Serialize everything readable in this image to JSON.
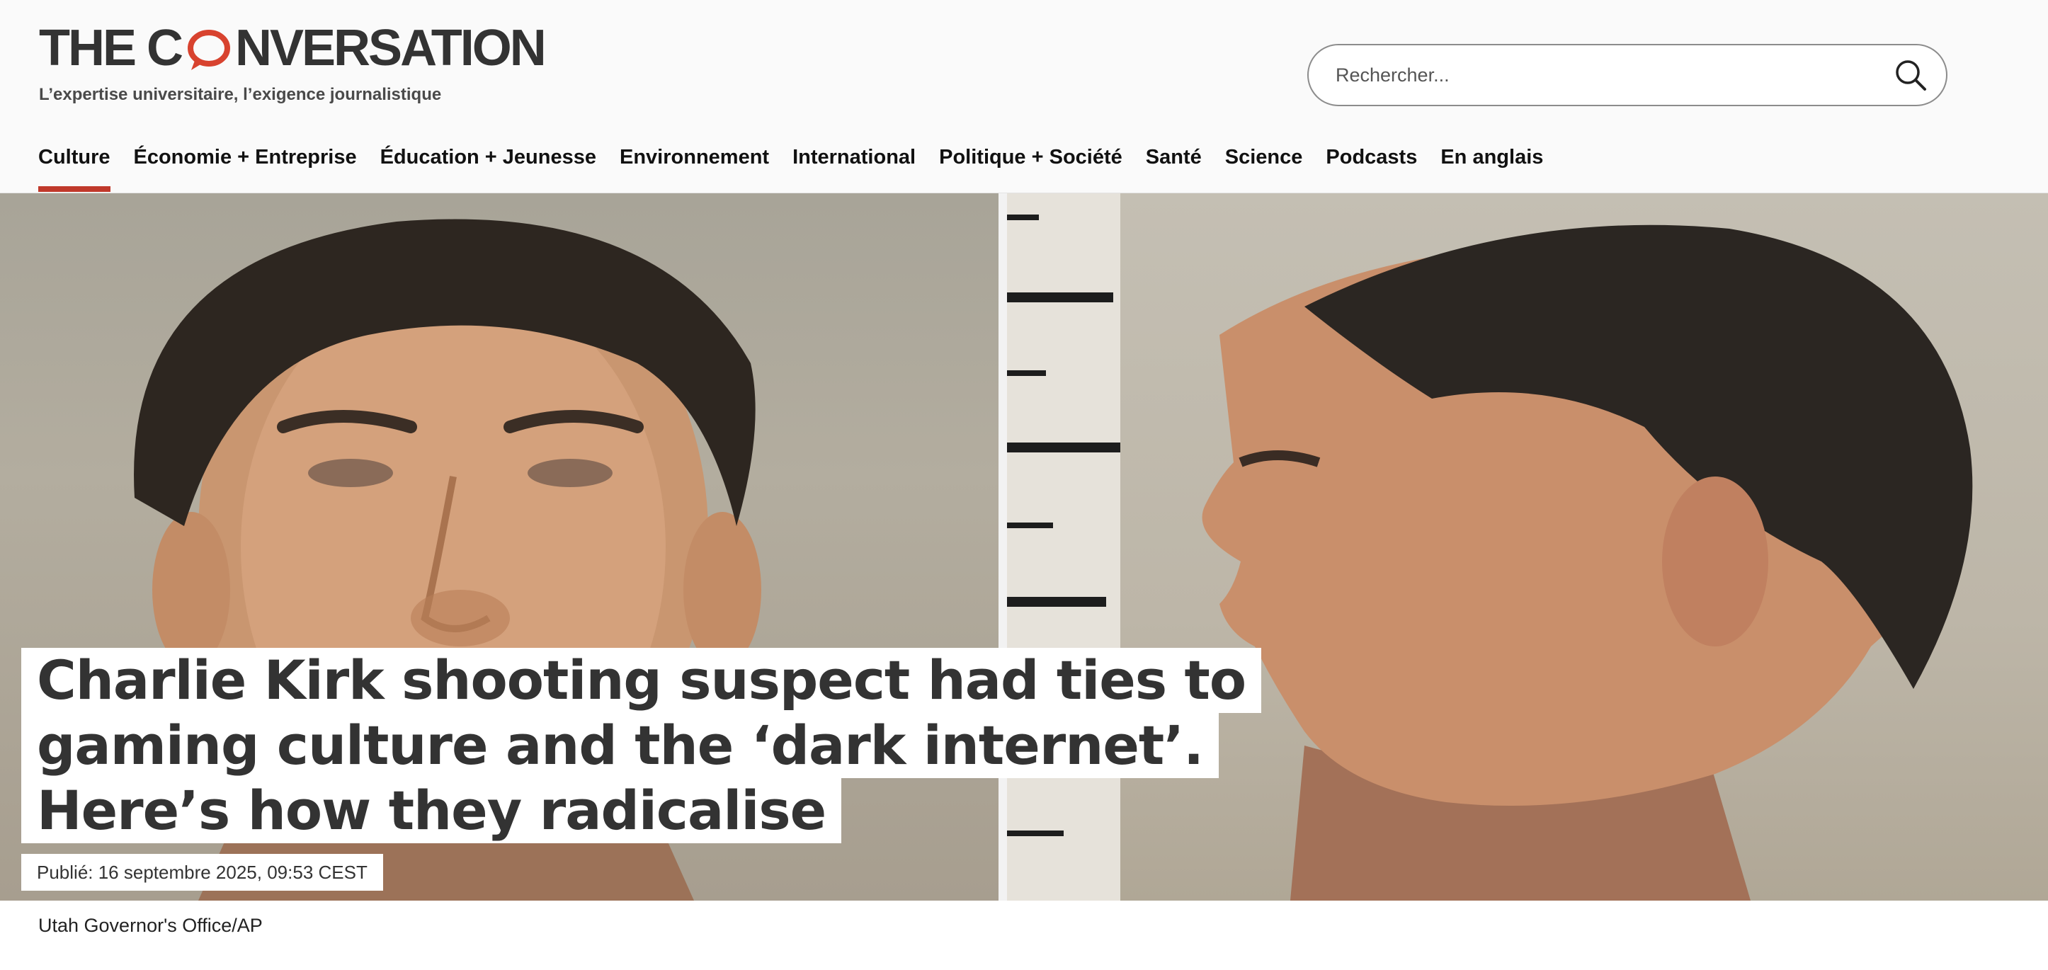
{
  "brand": {
    "logo_left": "THE C",
    "logo_right": "NVERSATION",
    "tagline": "L’expertise universitaire, l’exigence journalistique",
    "accent_color": "#c0392b"
  },
  "search": {
    "placeholder": "Rechercher...",
    "icon": "search-icon"
  },
  "nav": {
    "items": [
      {
        "label": "Culture",
        "active": true
      },
      {
        "label": "Économie + Entreprise"
      },
      {
        "label": "Éducation + Jeunesse"
      },
      {
        "label": "Environnement"
      },
      {
        "label": "International"
      },
      {
        "label": "Politique + Société"
      },
      {
        "label": "Santé"
      },
      {
        "label": "Science"
      },
      {
        "label": "Podcasts"
      },
      {
        "label": "En anglais"
      }
    ]
  },
  "article": {
    "title_lines": [
      "Charlie Kirk shooting suspect had ties to",
      "gaming culture and the ‘dark internet’.",
      "Here’s how they radicalise"
    ],
    "published": "Publié: 16 septembre 2025, 09:53 CEST",
    "image_credit": "Utah Governor's Office/AP"
  }
}
